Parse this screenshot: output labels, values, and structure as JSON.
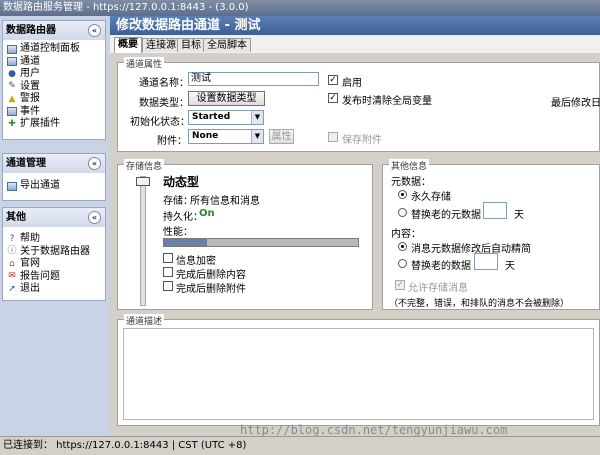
{
  "window": {
    "title": "数据路由服务管理 - https://127.0.0.1:8443 - (3.0.0)"
  },
  "sidebar": {
    "sections": [
      {
        "title": "数据路由器",
        "collapse": "«",
        "items": [
          {
            "label": "通道控制面板",
            "icon": "dashboard-icon"
          },
          {
            "label": "通道",
            "icon": "channel-icon"
          },
          {
            "label": "用户",
            "icon": "user-icon"
          },
          {
            "label": "设置",
            "icon": "settings-icon"
          },
          {
            "label": "警报",
            "icon": "alert-icon"
          },
          {
            "label": "事件",
            "icon": "event-icon"
          },
          {
            "label": "扩展插件",
            "icon": "plugin-icon"
          }
        ]
      },
      {
        "title": "通道管理",
        "collapse": "«",
        "items": [
          {
            "label": "导出通道",
            "icon": "export-icon"
          }
        ]
      },
      {
        "title": "其他",
        "collapse": "«",
        "items": [
          {
            "label": "帮助",
            "icon": "help-icon"
          },
          {
            "label": "关于数据路由器",
            "icon": "info-icon"
          },
          {
            "label": "官网",
            "icon": "home-icon"
          },
          {
            "label": "报告问题",
            "icon": "report-icon"
          },
          {
            "label": "退出",
            "icon": "logout-icon"
          }
        ]
      }
    ]
  },
  "main": {
    "title": "修改数据路由通道 - 测试",
    "tabs": [
      "概要",
      "连接源",
      "目标",
      "全局脚本"
    ],
    "active_tab": "概要"
  },
  "channel_props": {
    "legend": "通道属性",
    "name_label": "通道名称：",
    "name_value": "测试",
    "enabled_label": "启用",
    "enabled": true,
    "data_type_label": "数据类型：",
    "data_type_button": "设置数据类型",
    "clear_vars_label": "发布时清除全局变量",
    "clear_vars": true,
    "last_modified_label": "最后修改日期",
    "init_state_label": "初始化状态：",
    "init_state_value": "Started",
    "attachment_label": "附件：",
    "attachment_value": "None",
    "attr_button": "属性",
    "store_attachment_label": "保存附件",
    "store_attachment": false
  },
  "storage": {
    "legend": "存储信息",
    "mode_title": "动态型",
    "storage_label": "存储：",
    "storage_value": "所有信息和消息",
    "durable_label": "持久化：",
    "durable_value": "On",
    "performance_label": "性能：",
    "performance_level": 0.22,
    "encrypt_label": "信息加密",
    "remove_content_label": "完成后删除内容",
    "remove_attach_label": "完成后删除附件"
  },
  "other_info": {
    "legend": "其他信息",
    "metadata_label": "元数据：",
    "meta_keep_forever": "永久存储",
    "meta_prune_label": "替换老的元数据",
    "meta_days_unit": "天",
    "content_label": "内容：",
    "content_auto": "消息元数据修改后自动精简",
    "content_prune_label": "替换老的数据",
    "content_days_unit": "天",
    "allow_archive": "允许存储消息",
    "note": "（不完整，错误，和排队的消息不会被删除）"
  },
  "description": {
    "legend": "通道描述"
  },
  "status": {
    "text": "已连接到： https://127.0.0.1:8443 | CST (UTC +8)"
  },
  "watermark": "http://blog.csdn.net/tengyunjiawu.com"
}
